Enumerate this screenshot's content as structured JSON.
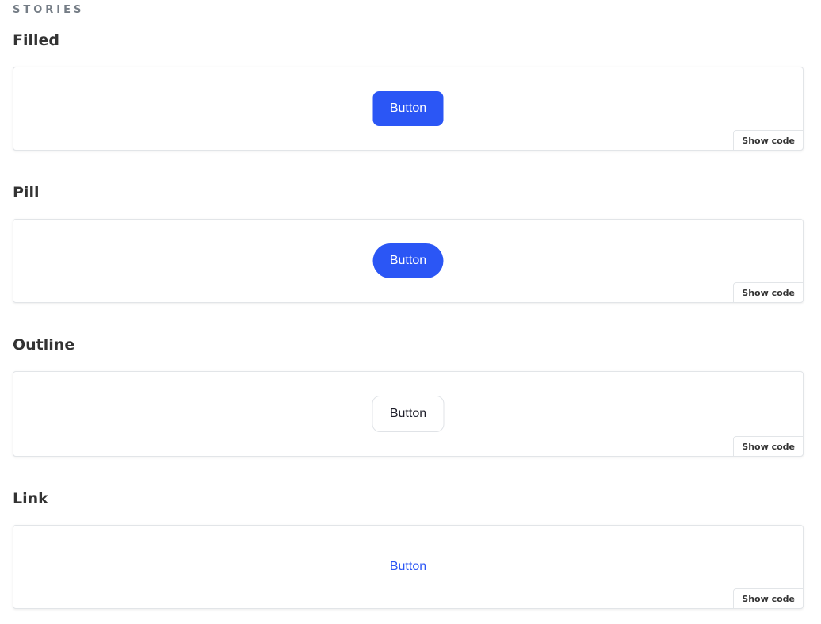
{
  "section_heading": "STORIES",
  "stories": [
    {
      "title": "Filled",
      "button_label": "Button",
      "show_code_label": "Show code"
    },
    {
      "title": "Pill",
      "button_label": "Button",
      "show_code_label": "Show code"
    },
    {
      "title": "Outline",
      "button_label": "Button",
      "show_code_label": "Show code"
    },
    {
      "title": "Link",
      "button_label": "Button",
      "show_code_label": "Show code"
    }
  ],
  "colors": {
    "primary": "#2b56f5",
    "heading_muted": "#757d86",
    "text": "#333333",
    "border": "#e2e5e8"
  }
}
